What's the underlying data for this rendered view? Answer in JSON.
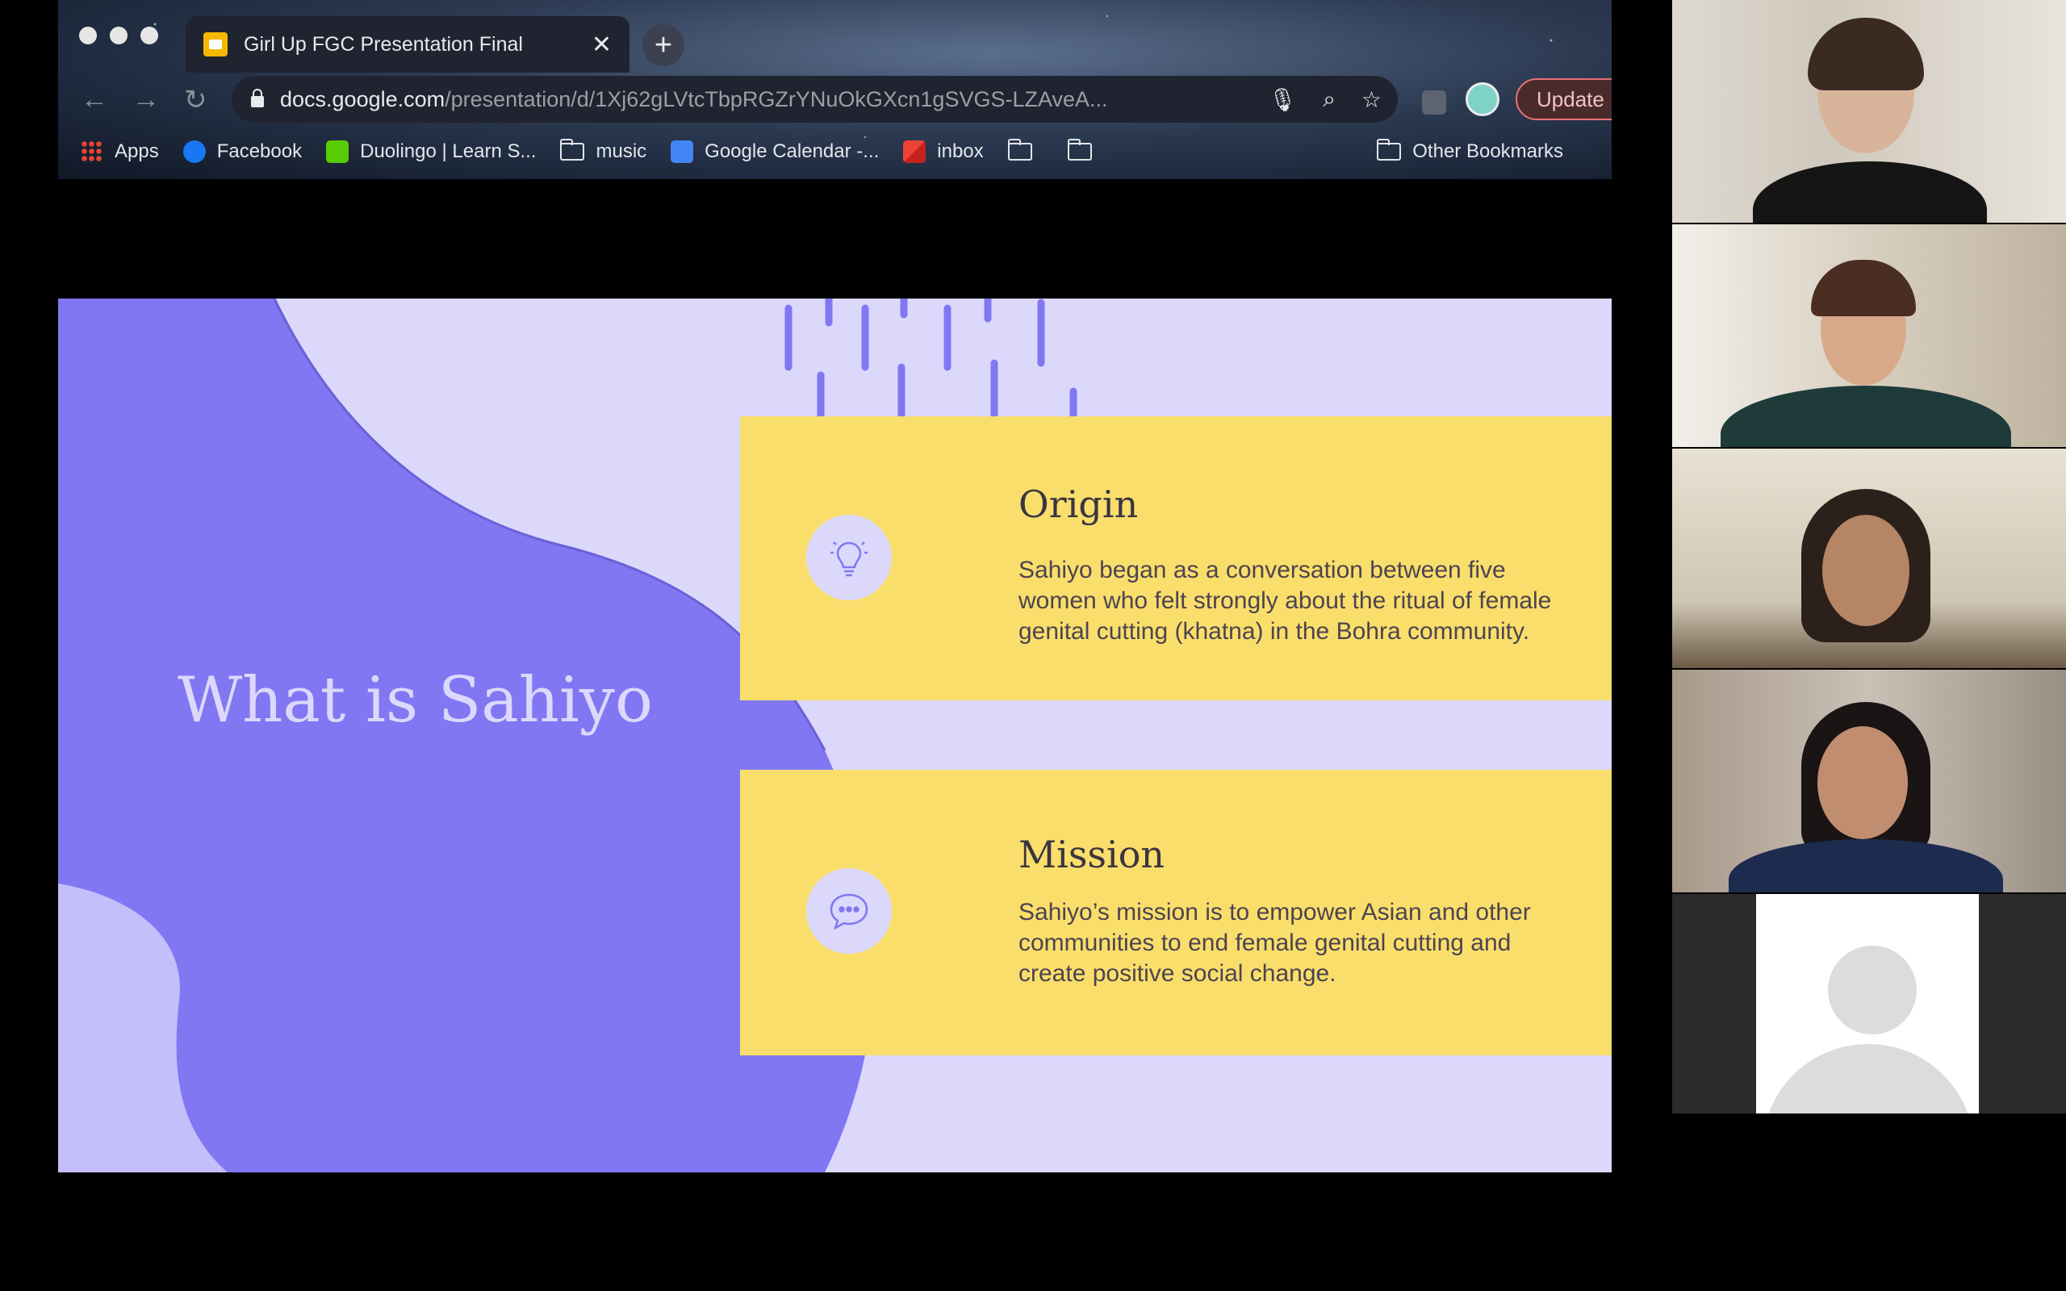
{
  "browser": {
    "tab_title": "Girl Up FGC Presentation Final",
    "new_tab_symbol": "+",
    "close_symbol": "✕",
    "url_host": "docs.google.com",
    "url_path": "/presentation/d/1Xj62gLVtcTbpRGZrYNuOkGXcn1gSVGS-LZAveA...",
    "update_label": "Update",
    "bookmarks": [
      {
        "label": "Apps",
        "icon": "apps-grid-icon"
      },
      {
        "label": "Facebook",
        "icon": "facebook-icon"
      },
      {
        "label": "Duolingo | Learn S...",
        "icon": "duolingo-icon"
      },
      {
        "label": "music",
        "icon": "folder-icon"
      },
      {
        "label": "Google Calendar -...",
        "icon": "calendar-icon"
      },
      {
        "label": "inbox",
        "icon": "gmail-icon"
      }
    ],
    "other_bookmarks": "Other Bookmarks"
  },
  "slide": {
    "title": "What is Sahiyo",
    "cards": [
      {
        "heading": "Origin",
        "icon": "lightbulb-icon",
        "body": "Sahiyo began as a conversation between five women who felt strongly about the ritual of female genital cutting (khatna) in the Bohra community."
      },
      {
        "heading": "Mission",
        "icon": "chat-bubble-icon",
        "body": "Sahiyo’s mission is to empower Asian and other communities to end female genital cutting and create positive social change."
      }
    ],
    "colors": {
      "background": "#dcd8fb",
      "blob": "#8177f2",
      "card": "#f9de6b"
    }
  },
  "participants": {
    "count": 5,
    "last_has_video": false
  }
}
